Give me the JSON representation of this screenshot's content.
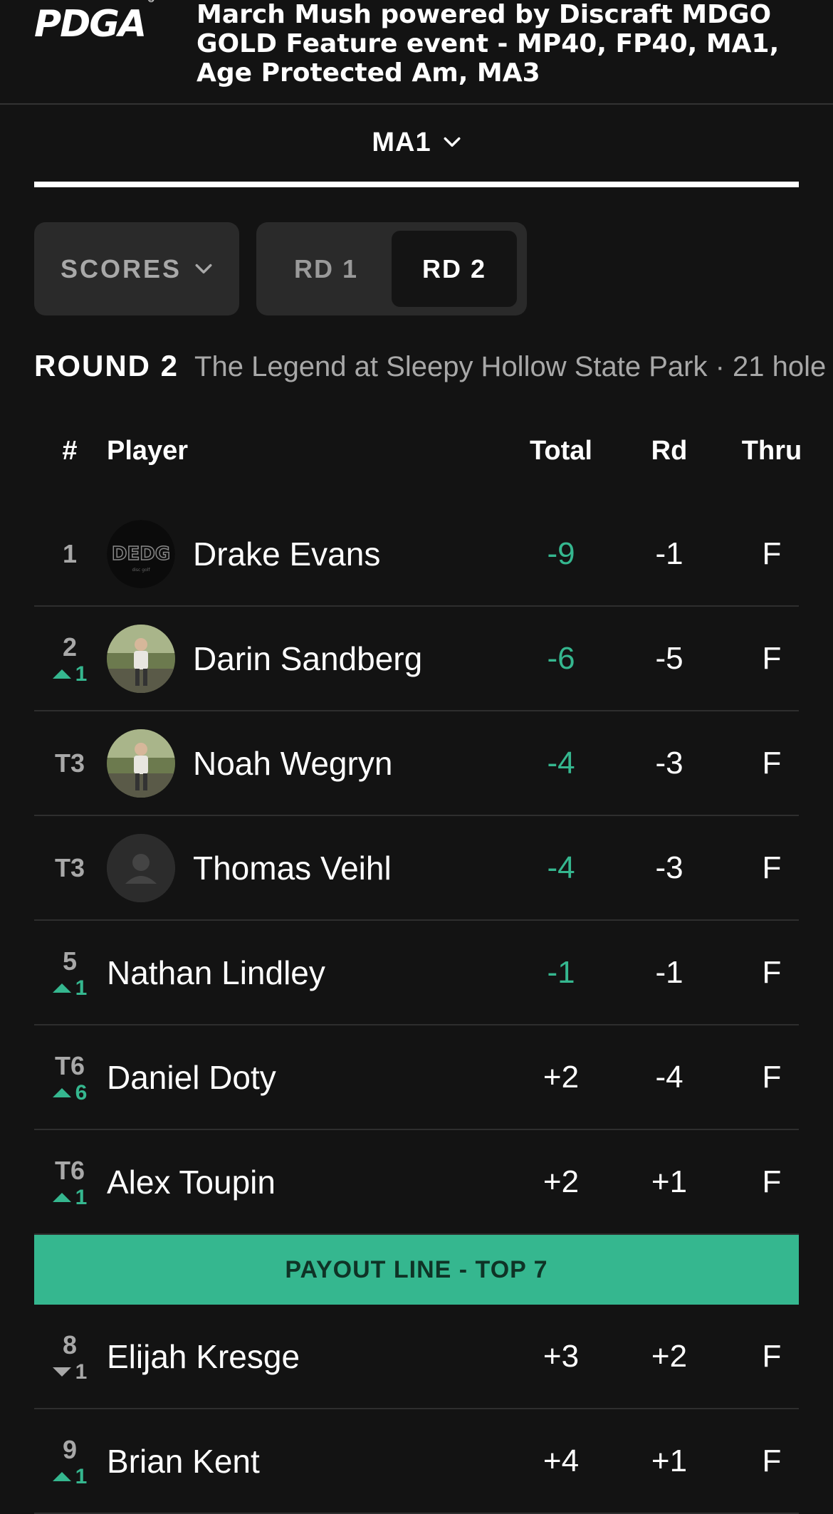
{
  "header": {
    "logo_text": "PDGA",
    "logo_mark": "®",
    "event_title": "March Mush powered by Discraft MDGO GOLD Feature event - MP40, FP40, MA1, Age Protected Am, MA3"
  },
  "division": {
    "label": "MA1",
    "icon": "chevron-down-icon"
  },
  "view_selector": {
    "label": "SCORES",
    "icon": "chevron-down-icon"
  },
  "rounds": {
    "rd1": "RD 1",
    "rd2": "RD 2",
    "selected": "RD 2"
  },
  "round_info": {
    "label": "ROUND 2",
    "course": "The Legend at Sleepy Hollow State Park · 21 hole"
  },
  "table": {
    "headers": {
      "rank": "#",
      "player": "Player",
      "total": "Total",
      "rd": "Rd",
      "thru": "Thru"
    },
    "rows_before_payout": [
      {
        "rank": "1",
        "move": "",
        "move_dir": "",
        "name": "Drake Evans",
        "avatar": "logo",
        "total": "-9",
        "rd": "-1",
        "thru": "F"
      },
      {
        "rank": "2",
        "move": "1",
        "move_dir": "up",
        "name": "Darin Sandberg",
        "avatar": "photo",
        "total": "-6",
        "rd": "-5",
        "thru": "F"
      },
      {
        "rank": "T3",
        "move": "",
        "move_dir": "",
        "name": "Noah Wegryn",
        "avatar": "photo",
        "total": "-4",
        "rd": "-3",
        "thru": "F"
      },
      {
        "rank": "T3",
        "move": "",
        "move_dir": "",
        "name": "Thomas Veihl",
        "avatar": "placeholder",
        "total": "-4",
        "rd": "-3",
        "thru": "F"
      },
      {
        "rank": "5",
        "move": "1",
        "move_dir": "up",
        "name": "Nathan Lindley",
        "avatar": "",
        "total": "-1",
        "rd": "-1",
        "thru": "F"
      },
      {
        "rank": "T6",
        "move": "6",
        "move_dir": "up",
        "name": "Daniel Doty",
        "avatar": "",
        "total": "+2",
        "rd": "-4",
        "thru": "F"
      },
      {
        "rank": "T6",
        "move": "1",
        "move_dir": "up",
        "name": "Alex Toupin",
        "avatar": "",
        "total": "+2",
        "rd": "+1",
        "thru": "F"
      }
    ],
    "payout_label": "PAYOUT LINE - TOP 7",
    "rows_after_payout": [
      {
        "rank": "8",
        "move": "1",
        "move_dir": "down",
        "name": "Elijah Kresge",
        "avatar": "",
        "total": "+3",
        "rd": "+2",
        "thru": "F"
      },
      {
        "rank": "9",
        "move": "1",
        "move_dir": "up",
        "name": "Brian Kent",
        "avatar": "",
        "total": "+4",
        "rd": "+1",
        "thru": "F"
      }
    ]
  },
  "colors": {
    "background": "#131313",
    "accent": "#35b78f",
    "muted": "#a8a8a8"
  }
}
